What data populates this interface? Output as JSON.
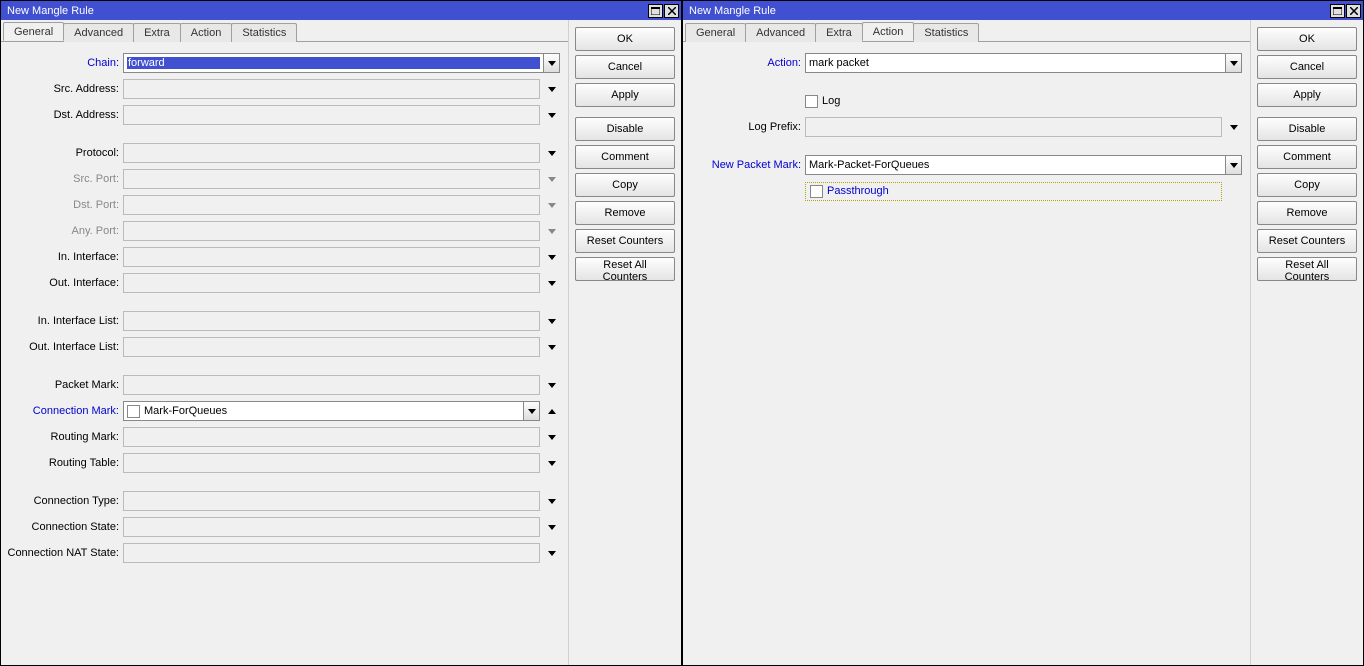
{
  "window_title": "New Mangle Rule",
  "tabs": [
    "General",
    "Advanced",
    "Extra",
    "Action",
    "Statistics"
  ],
  "left_active_tab": "General",
  "right_active_tab": "Action",
  "buttons": {
    "ok": "OK",
    "cancel": "Cancel",
    "apply": "Apply",
    "disable": "Disable",
    "comment": "Comment",
    "copy": "Copy",
    "remove": "Remove",
    "reset_counters": "Reset Counters",
    "reset_all_counters": "Reset All Counters"
  },
  "general": {
    "labels": {
      "chain": "Chain:",
      "src_address": "Src. Address:",
      "dst_address": "Dst. Address:",
      "protocol": "Protocol:",
      "src_port": "Src. Port:",
      "dst_port": "Dst. Port:",
      "any_port": "Any. Port:",
      "in_interface": "In. Interface:",
      "out_interface": "Out. Interface:",
      "in_interface_list": "In. Interface List:",
      "out_interface_list": "Out. Interface List:",
      "packet_mark": "Packet Mark:",
      "connection_mark": "Connection Mark:",
      "routing_mark": "Routing Mark:",
      "routing_table": "Routing Table:",
      "connection_type": "Connection Type:",
      "connection_state": "Connection State:",
      "connection_nat_state": "Connection NAT State:"
    },
    "values": {
      "chain": "forward",
      "connection_mark": "Mark-ForQueues"
    }
  },
  "action": {
    "labels": {
      "action": "Action:",
      "log": "Log",
      "log_prefix": "Log Prefix:",
      "new_packet_mark": "New Packet Mark:",
      "passthrough": "Passthrough"
    },
    "values": {
      "action": "mark packet",
      "new_packet_mark": "Mark-Packet-ForQueues"
    }
  }
}
